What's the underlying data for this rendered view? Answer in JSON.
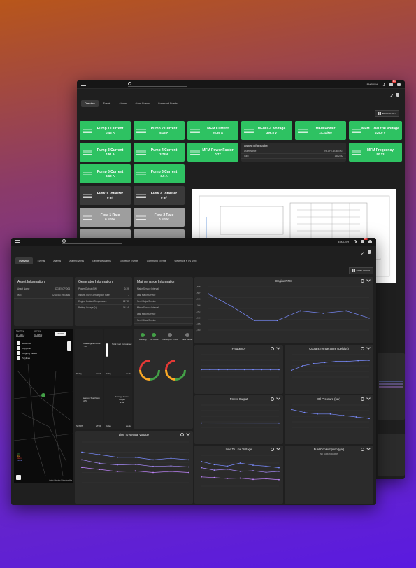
{
  "back": {
    "lang": "ENGLISH",
    "notif_count": "99+",
    "tabs": [
      "Overview",
      "Events",
      "Alarms",
      "Alarm Events",
      "Command Events"
    ],
    "edit_layout": "EDIT LAYOUT",
    "tiles": [
      {
        "title": "Pump 1 Current",
        "value": "0.43 A",
        "color": "green"
      },
      {
        "title": "Pump 2 Current",
        "value": "5.16 A",
        "color": "green"
      },
      {
        "title": "MFM Current",
        "value": "26.89 A",
        "color": "green"
      },
      {
        "title": "MFM L-L Voltage",
        "value": "396.5 V",
        "color": "green"
      },
      {
        "title": "MFM Power",
        "value": "14.31 kW",
        "color": "green"
      },
      {
        "title": "MFM L-Neutral Voltage",
        "value": "229.0 V",
        "color": "green"
      },
      {
        "title": "Pump 3 Current",
        "value": "4.51 A",
        "color": "green"
      },
      {
        "title": "Pump 4 Current",
        "value": "3.78 A",
        "color": "green"
      },
      {
        "title": "MFM Power Factor",
        "value": "0.77",
        "color": "green"
      },
      {
        "title": "MFM Frequency",
        "value": "50.13",
        "color": "green"
      },
      {
        "title": "Pump 5 Current",
        "value": "3.60 A",
        "color": "green"
      },
      {
        "title": "Pump 6 Current",
        "value": "3.5 A",
        "color": "green"
      },
      {
        "title": "Flow 1 Totalizer",
        "value": "0 m³",
        "color": "dark"
      },
      {
        "title": "Flow 2 Totalizer",
        "value": "0 m³",
        "color": "dark"
      },
      {
        "title": "Flow 1 Rate",
        "value": "0 m³/hr",
        "color": "gray"
      },
      {
        "title": "Flow 2 Rate",
        "value": "0 m³/hr",
        "color": "gray"
      }
    ],
    "asset_info": {
      "title": "Asset Information",
      "rows": [
        {
          "k": "Asset Name",
          "v": "RL-LFT-NGB0-001"
        },
        {
          "k": "IMEI",
          "v": "1382282"
        }
      ]
    }
  },
  "front": {
    "lang": "ENGLISH",
    "notif_count": "99+",
    "tabs": [
      "Overview",
      "Events",
      "Alarms",
      "Alarm Events",
      "Geofence Alarms",
      "Geofence Events",
      "Command Events",
      "Geofence NTN Sync"
    ],
    "edit_layout": "EDIT LAYOUT",
    "asset_info": {
      "title": "Asset Information",
      "rows": [
        {
          "k": "Asset Name",
          "v": "DG-ESCP-004"
        },
        {
          "k": "IMEI",
          "v": "0243 5472903884"
        }
      ]
    },
    "generator_info": {
      "title": "Generator Information",
      "rows": [
        {
          "k": "Power Output (kW)",
          "v": "0.39"
        },
        {
          "k": "Instant. Fuel Consumption Rate",
          "v": "-"
        },
        {
          "k": "Engine Coolant Temperature",
          "v": "82 °C"
        },
        {
          "k": "Battery Voltage (V)",
          "v": "14.14"
        }
      ]
    },
    "maintenance_info": {
      "title": "Maintenance Information",
      "rows": [
        {
          "k": "Major Service Interval",
          "v": "-"
        },
        {
          "k": "Last Major Service",
          "v": "-"
        },
        {
          "k": "Next Major Service",
          "v": "-"
        },
        {
          "k": "Minor Service Interval",
          "v": "-"
        },
        {
          "k": "Last Minor Service",
          "v": "-"
        },
        {
          "k": "Next Minor Service",
          "v": "-"
        }
      ]
    },
    "map": {
      "start_label": "Start Time",
      "end_label": "End Time",
      "start": "07 Jun 2",
      "end": "07 Jun 2",
      "filter": "FILTER",
      "layers": [
        "Geofence",
        "Waypoints",
        "Outgoing Labels",
        "Polylines"
      ],
      "legend": [
        "Off",
        "Idle",
        "Alarm",
        "Cluster"
      ],
      "attribution": "Leaflet | Map data © OpenStreetMap"
    },
    "gen_tiles": [
      {
        "label": "Total Engine Hours",
        "value": "7.58",
        "foot_l": "Today",
        "foot_r": "week"
      },
      {
        "label": "Total Fuel Consumed",
        "value": "",
        "foot_l": "Today",
        "foot_r": "week"
      },
      {
        "label": "Session Start/Stop",
        "value": "10.5",
        "foot_l": "START",
        "foot_r": "STOP"
      },
      {
        "label": "Average Power Output",
        "value": "9.42",
        "foot_l": "Today",
        "foot_r": "week"
      }
    ],
    "status": [
      {
        "label": "Running",
        "color": "#43a047"
      },
      {
        "label": "Oil Check",
        "color": "#43a047"
      },
      {
        "label": "Fuel Report Check",
        "color": "#777"
      },
      {
        "label": "Fault Report",
        "color": "#777"
      }
    ],
    "charts": {
      "engine_rpm": "Engine RPM",
      "frequency": "Frequency",
      "coolant": "Coolant Temperature (Celsius)",
      "power": "Power Output",
      "oil": "Oil Pressure (bar)",
      "ltn": "Line To Neutral Voltage",
      "ltl": "Line To Line Voltage",
      "fuel": "Fuel Consumption (gal)",
      "fuel_empty": "No Data Available",
      "colors": {
        "line": "#7a8cff",
        "line2": "#a78bfa",
        "grid": "#3a3a3a"
      }
    }
  },
  "chart_data": [
    {
      "type": "line",
      "title": "Engine RPM",
      "y": [
        1507,
        1502,
        1496,
        1496,
        1500,
        1499,
        1500,
        1497
      ],
      "ylim": [
        1492,
        1510
      ],
      "y_ticks": [
        "1,508",
        "1,507",
        "1,506",
        "1,504",
        "1,502",
        "1,500",
        "1,495",
        "1,493"
      ]
    },
    {
      "type": "line",
      "title": "Frequency",
      "y": [
        50,
        50,
        50,
        50,
        50,
        50,
        50,
        50,
        50,
        50
      ],
      "ylim": [
        40,
        70
      ]
    },
    {
      "type": "line",
      "title": "Coolant Temperature (Celsius)",
      "y": [
        78,
        80,
        81,
        81.5,
        82,
        82,
        82.3,
        82.5
      ],
      "ylim": [
        75,
        85
      ]
    },
    {
      "type": "line",
      "title": "Power Output",
      "y": [
        0.4,
        0.39
      ],
      "ylim": [
        0,
        2
      ]
    },
    {
      "type": "line",
      "title": "Oil Pressure (bar)",
      "y": [
        3.42,
        3.4,
        3.39,
        3.39,
        3.38,
        3.37,
        3.36
      ],
      "ylim": [
        3.3,
        3.45
      ]
    },
    {
      "type": "line",
      "title": "Line To Neutral Voltage",
      "series": [
        {
          "values": [
            232,
            231.5,
            231,
            231,
            230.5,
            230.8,
            230.5
          ]
        },
        {
          "values": [
            230.5,
            229.8,
            229.5,
            229.6,
            229.2,
            229.3,
            229.1
          ]
        },
        {
          "values": [
            229,
            228.6,
            228.2,
            228.3,
            228,
            228.2,
            228
          ]
        }
      ],
      "ylim": [
        226,
        234
      ]
    },
    {
      "type": "line",
      "title": "Line To Line Voltage",
      "series": [
        {
          "values": [
            400,
            399,
            398.5,
            399.5,
            398.8,
            398.5,
            398
          ]
        },
        {
          "values": [
            398,
            397.2,
            397.5,
            396.8,
            397,
            396.5,
            396.8
          ]
        },
        {
          "values": [
            395,
            394.8,
            394.5,
            394.6,
            394.2,
            394.4,
            394.1
          ]
        }
      ],
      "ylim": [
        392,
        402
      ]
    }
  ]
}
